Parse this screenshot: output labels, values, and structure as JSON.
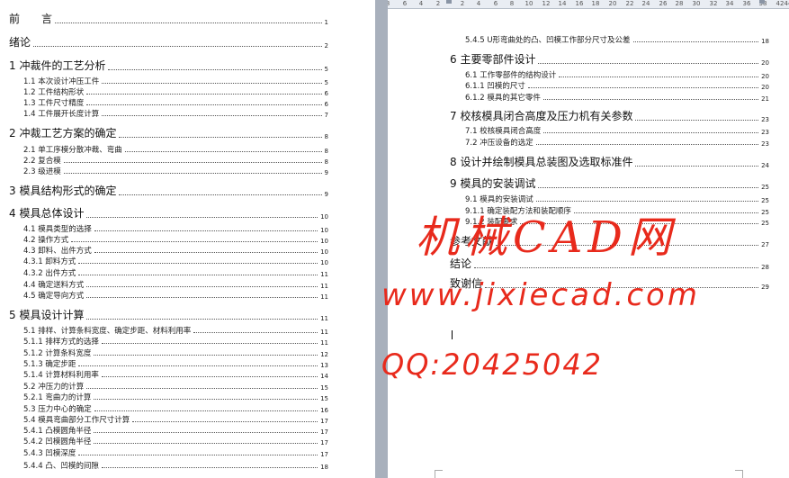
{
  "ruler": {
    "ticks": [
      "8",
      "6",
      "4",
      "2",
      "2",
      "4",
      "6",
      "8",
      "10",
      "12",
      "14",
      "16",
      "18",
      "20",
      "22",
      "24",
      "26",
      "28",
      "30",
      "32",
      "34",
      "36",
      "38",
      "42",
      "44"
    ]
  },
  "left_page": {
    "entries": [
      {
        "level": 1,
        "label": "前　　言",
        "page": "1"
      },
      {
        "level": 1,
        "label": "绪论",
        "page": "2"
      },
      {
        "level": 1,
        "label": "1  冲裁件的工艺分析",
        "page": "5"
      },
      {
        "level": 2,
        "label": "1.1 本次设计冲压工件",
        "page": "5"
      },
      {
        "level": 2,
        "label": "1.2 工件结构形状",
        "page": "6"
      },
      {
        "level": 2,
        "label": "1.3 工件尺寸精度",
        "page": "6"
      },
      {
        "level": 2,
        "label": "1.4 工件展开长度计算",
        "page": "7"
      },
      {
        "level": 1,
        "label": "2  冲裁工艺方案的确定",
        "page": "8"
      },
      {
        "level": 2,
        "label": "2.1 单工序模分散冲裁、弯曲",
        "page": "8"
      },
      {
        "level": 2,
        "label": "2.2 复合模",
        "page": "8"
      },
      {
        "level": 2,
        "label": "2.3 级进模",
        "page": "9"
      },
      {
        "level": 1,
        "label": "3  模具结构形式的确定",
        "page": "9"
      },
      {
        "level": 1,
        "label": "4  模具总体设计",
        "page": "10"
      },
      {
        "level": 2,
        "label": "4.1 模具类型的选择",
        "page": "10"
      },
      {
        "level": 2,
        "label": "4.2 操作方式",
        "page": "10"
      },
      {
        "level": 2,
        "label": "4.3 卸料、出件方式",
        "page": "10"
      },
      {
        "level": 2,
        "label": "4.3.1 卸料方式",
        "page": "10"
      },
      {
        "level": 2,
        "label": "4.3.2 出件方式",
        "page": "11"
      },
      {
        "level": 2,
        "label": "4.4 确定送料方式",
        "page": "11"
      },
      {
        "level": 2,
        "label": "4.5 确定导向方式",
        "page": "11"
      },
      {
        "level": 1,
        "label": "5  模具设计计算",
        "page": "11"
      },
      {
        "level": 2,
        "label": "5.1 排样、计算条料宽度、确定步距、材料利用率",
        "page": "11"
      },
      {
        "level": 2,
        "label": "5.1.1 排样方式的选择",
        "page": "11"
      },
      {
        "level": 2,
        "label": "5.1.2 计算条料宽度",
        "page": "12"
      },
      {
        "level": 2,
        "label": "5.1.3 确定步距",
        "page": "13"
      },
      {
        "level": 2,
        "label": "5.1.4 计算材料利用率",
        "page": "14"
      },
      {
        "level": 2,
        "label": "5.2 冲压力的计算",
        "page": "15"
      },
      {
        "level": 2,
        "label": "5.2.1 弯曲力的计算",
        "page": "15"
      },
      {
        "level": 2,
        "label": "5.3 压力中心的确定",
        "page": "16"
      },
      {
        "level": 2,
        "label": "5.4 模具弯曲部分工作尺寸计算",
        "page": "17"
      },
      {
        "level": 2,
        "label": "5.4.1 凸模圆角半径",
        "page": "17"
      },
      {
        "level": 2,
        "label": "5.4.2 凹模圆角半径",
        "page": "17"
      },
      {
        "level": 2,
        "label": "5.4.3 凹模深度",
        "page": "17"
      },
      {
        "level": 2,
        "label": "5.4.4  凸、凹模的间隙",
        "page": "18"
      }
    ]
  },
  "right_page": {
    "entries": [
      {
        "level": 2,
        "label": "5.4.5  U形弯曲处的凸、凹模工作部分尺寸及公差",
        "page": "18"
      },
      {
        "level": 1,
        "label": "6  主要零部件设计",
        "page": "20"
      },
      {
        "level": 2,
        "label": "6.1 工作零部件的结构设计",
        "page": "20"
      },
      {
        "level": 2,
        "label": "6.1.1 凹模的尺寸",
        "page": "20"
      },
      {
        "level": 2,
        "label": "6.1.2 模具的其它零件",
        "page": "21"
      },
      {
        "level": 1,
        "label": "7  校核模具闭合高度及压力机有关参数",
        "page": "23"
      },
      {
        "level": 2,
        "label": "7.1 校核模具闭合高度",
        "page": "23"
      },
      {
        "level": 2,
        "label": "7.2 冲压设备的选定",
        "page": "23"
      },
      {
        "level": 1,
        "label": "8  设计并绘制模具总装图及选取标准件",
        "page": "24"
      },
      {
        "level": 1,
        "label": "9  模具的安装调试",
        "page": "25"
      },
      {
        "level": 2,
        "label": "9.1 模具的安装调试",
        "page": "25"
      },
      {
        "level": 2,
        "label": "9.1.1 确定装配方法和装配顺序",
        "page": "25"
      },
      {
        "level": 2,
        "label": "9.1.2 装配要求",
        "page": "25"
      },
      {
        "level": 1,
        "label": "参考文献",
        "page": "27"
      },
      {
        "level": 1,
        "label": "结论",
        "page": "28"
      },
      {
        "level": 1,
        "label": "致谢信",
        "page": "29"
      }
    ]
  },
  "watermark": {
    "line1": "机械CAD网",
    "line2": "www.jixiecad.com",
    "line3": "QQ:20425042",
    "color": "#e82a1c"
  }
}
